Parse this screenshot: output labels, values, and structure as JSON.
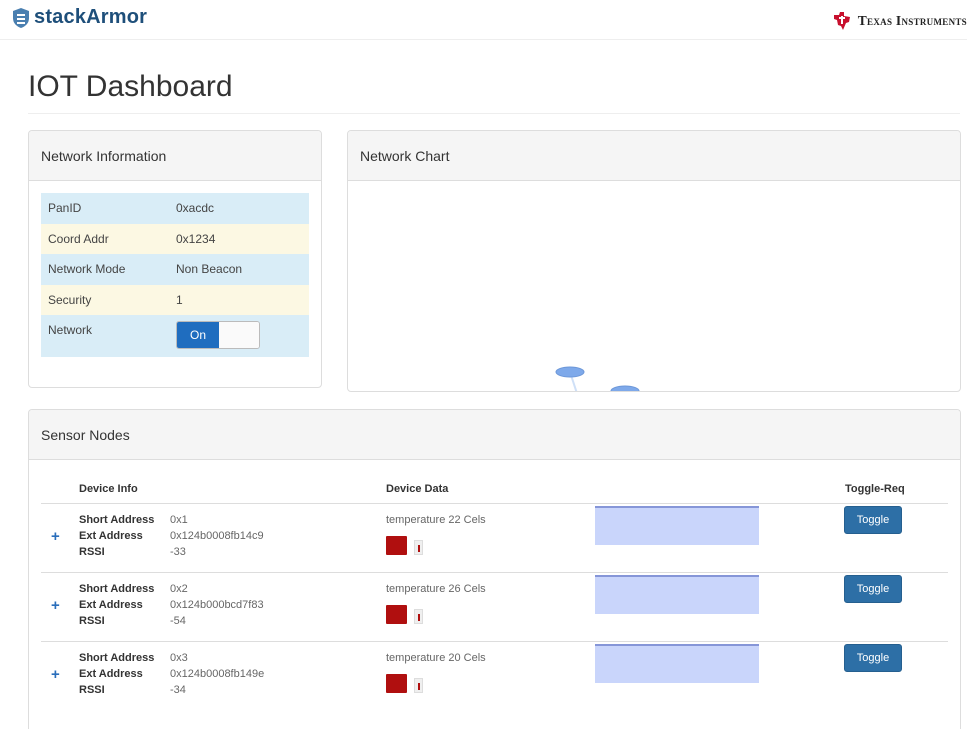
{
  "header": {
    "brand": "stackArmor",
    "partner": "Texas Instruments",
    "colors": {
      "brand": "#1e4f7a",
      "ti_red": "#c8102e"
    }
  },
  "page": {
    "title": "IOT Dashboard"
  },
  "network_info": {
    "title": "Network Information",
    "rows": [
      {
        "label": "PanID",
        "value": "0xacdc"
      },
      {
        "label": "Coord Addr",
        "value": "0x1234"
      },
      {
        "label": "Network Mode",
        "value": "Non Beacon"
      },
      {
        "label": "Security",
        "value": "1"
      },
      {
        "label": "Network",
        "value": ""
      }
    ],
    "network_switch": {
      "on_label": "On",
      "state": true
    }
  },
  "network_chart": {
    "title": "Network Chart",
    "center_node": "",
    "nodes": [
      "",
      "",
      "",
      "",
      ""
    ]
  },
  "sensor_nodes": {
    "title": "Sensor Nodes",
    "columns": [
      "Device Info",
      "Device Data",
      "Toggle-Req"
    ],
    "field_labels": {
      "short": "Short Address",
      "ext": "Ext Address",
      "rssi": "RSSI"
    },
    "devices": [
      {
        "short": "0x1",
        "ext": "0x124b0008fb14c9",
        "rssi": "-33",
        "data": "temperature 22 Cels",
        "button": "Toggle"
      },
      {
        "short": "0x2",
        "ext": "0x124b000bcd7f83",
        "rssi": "-54",
        "data": "temperature 26 Cels",
        "button": "Toggle"
      },
      {
        "short": "0x3",
        "ext": "0x124b0008fb149e",
        "rssi": "-34",
        "data": "temperature 20 Cels",
        "button": "Toggle"
      }
    ]
  }
}
